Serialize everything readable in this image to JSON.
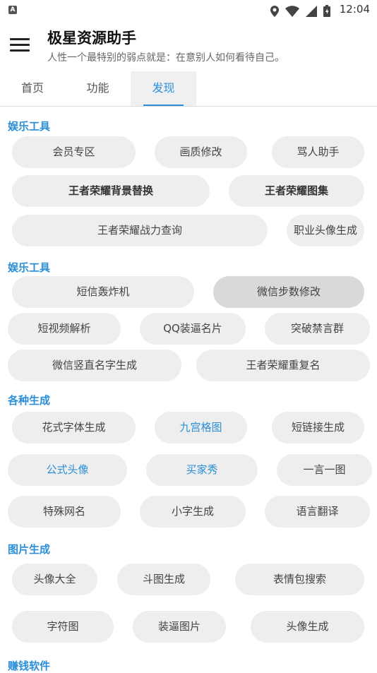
{
  "status_bar": {
    "time": "12:04",
    "notif_letter": "A"
  },
  "header": {
    "title": "极星资源助手",
    "subtitle": "人性一个最特别的弱点就是：在意别人如何看待自己。"
  },
  "tabs": [
    {
      "label": "首页"
    },
    {
      "label": "功能"
    },
    {
      "label": "发现"
    }
  ],
  "sections": [
    {
      "title": "娱乐工具",
      "chips": [
        "会员专区",
        "画质修改",
        "骂人助手",
        "王者荣耀背景替换",
        "王者荣耀图集",
        "王者荣耀战力查询",
        "职业头像生成"
      ]
    },
    {
      "title": "娱乐工具",
      "chips": [
        "短信轰炸机",
        "微信步数修改",
        "短视频解析",
        "QQ装逼名片",
        "突破禁言群",
        "微信竖直名字生成",
        "王者荣耀重复名"
      ]
    },
    {
      "title": "各种生成",
      "chips": [
        "花式字体生成",
        "九宫格图",
        "短链接生成",
        "公式头像",
        "买家秀",
        "一言一图",
        "特殊网名",
        "小字生成",
        "语言翻译"
      ]
    },
    {
      "title": "图片生成",
      "chips": [
        "头像大全",
        "斗图生成",
        "表情包搜索",
        "字符图",
        "装逼图片",
        "头像生成"
      ]
    },
    {
      "title": "赚钱软件",
      "chips": []
    }
  ]
}
